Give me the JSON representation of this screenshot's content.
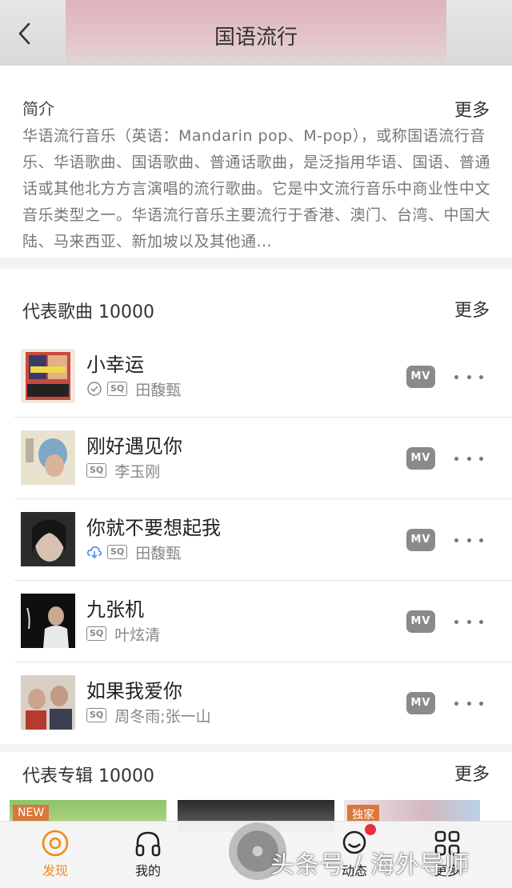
{
  "header": {
    "title": "国语流行",
    "back_icon": "chevron-left-icon"
  },
  "intro": {
    "title": "简介",
    "more": "更多",
    "text": "华语流行音乐（英语：Mandarin pop、M-pop），或称国语流行音乐、华语歌曲、国语歌曲、普通话歌曲，是泛指用华语、国语、普通话或其他北方方言演唱的流行歌曲。它是中文流行音乐中商业性中文音乐类型之一。华语流行音乐主要流行于香港、澳门、台湾、中国大陆、马来西亚、新加坡以及其他通…"
  },
  "songs_section": {
    "title": "代表歌曲 10000",
    "more": "更多"
  },
  "songs": [
    {
      "name": "小幸运",
      "artist": "田馥甄",
      "icons": [
        "check-circle-icon",
        "sq-badge"
      ],
      "mv_label": "MV"
    },
    {
      "name": "刚好遇见你",
      "artist": "李玉刚",
      "icons": [
        "sq-badge"
      ],
      "mv_label": "MV"
    },
    {
      "name": "你就不要想起我",
      "artist": "田馥甄",
      "icons": [
        "cloud-download-icon",
        "sq-badge"
      ],
      "mv_label": "MV"
    },
    {
      "name": "九张机",
      "artist": "叶炫清",
      "icons": [
        "sq-badge"
      ],
      "mv_label": "MV"
    },
    {
      "name": "如果我爱你",
      "artist": "周冬雨;张一山",
      "icons": [
        "sq-badge"
      ],
      "mv_label": "MV"
    }
  ],
  "sq_label": "SQ",
  "albums_section": {
    "title": "代表专辑 10000",
    "more": "更多"
  },
  "albums": [
    {
      "tag": "NEW"
    },
    {
      "tag": ""
    },
    {
      "tag": "独家"
    }
  ],
  "bottom_nav": [
    {
      "label": "发现",
      "icon": "disc-icon",
      "active": true
    },
    {
      "label": "我的",
      "icon": "headphones-icon",
      "active": false
    },
    {
      "label": "动态",
      "icon": "chat-bubble-icon",
      "active": false
    },
    {
      "label": "更多",
      "icon": "grid-icon",
      "active": false
    }
  ],
  "watermark": "头条号 / 海外导师",
  "colors": {
    "accent": "#f08a1c",
    "mv_badge": "#8a8a8a",
    "notification": "#e8303e"
  }
}
